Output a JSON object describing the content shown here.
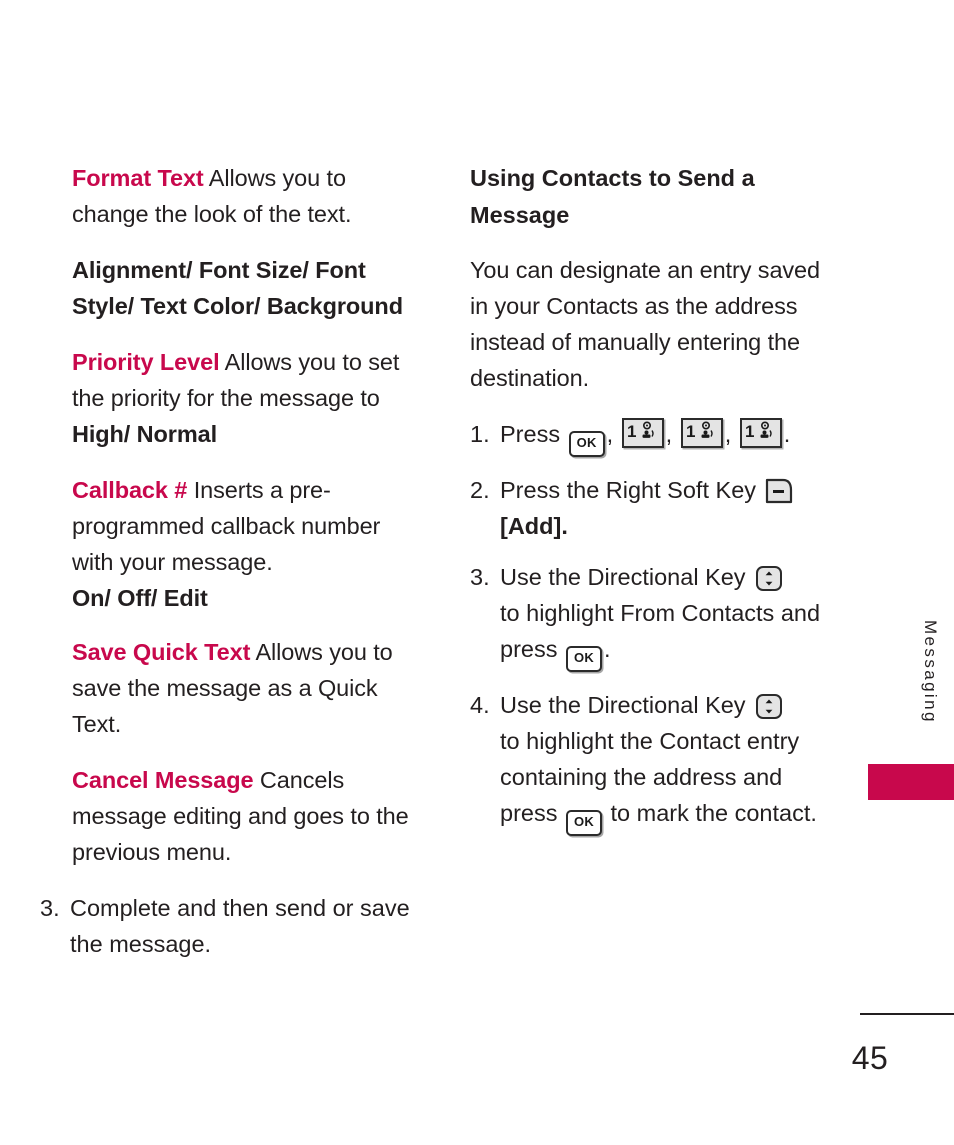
{
  "page": {
    "number": "45",
    "side_tab_label": "Messaging",
    "accent_color": "#c8084c",
    "text_color": "#231f20"
  },
  "left_column": {
    "entries": [
      {
        "term": "Format Text",
        "description": "Allows you to change the look of the text."
      },
      {
        "term": "",
        "options": "Alignment/ Font Size/ Font Style/ Text Color/ Background"
      },
      {
        "term": "Priority Level",
        "description": "Allows you to set the priority for the message to ",
        "options_inline": "High/ Normal"
      },
      {
        "term": "Callback #",
        "description": "Inserts a pre-programmed callback number with your message.",
        "options": "On/ Off/ Edit"
      },
      {
        "term": "Save Quick Text",
        "description": "Allows you to save the message as a Quick Text."
      },
      {
        "term": "Cancel Message",
        "description": "Cancels message editing and goes to the previous menu."
      }
    ],
    "step": {
      "number": "3.",
      "text": "Complete and then send or save the message."
    }
  },
  "right_column": {
    "heading": "Using Contacts to Send a Message",
    "intro": "You can designate an entry saved in your Contacts as the address instead of manually entering the destination.",
    "steps": [
      {
        "number": "1.",
        "text_before": "Press",
        "keys": [
          "ok-key",
          "number-one-key",
          "number-one-key",
          "number-one-key"
        ],
        "separators": [
          ",",
          ",",
          ",",
          "."
        ],
        "text_after": ""
      },
      {
        "number": "2.",
        "text_before": "Press the Right Soft Key",
        "key": "right-soft-key",
        "text_after": "",
        "bracket_label": "[Add]",
        "bracket_bold": "Add"
      },
      {
        "number": "3.",
        "text_before": "Use the Directional Key",
        "key": "directional-key",
        "text_mid": "to highlight From Contacts and press",
        "key2": "ok-key",
        "text_after": "."
      },
      {
        "number": "4.",
        "text_before": "Use the Directional Key",
        "key": "directional-key",
        "text_mid": "to highlight the Contact entry containing the address and press",
        "key2": "ok-key",
        "text_after": "to mark the contact."
      }
    ]
  }
}
